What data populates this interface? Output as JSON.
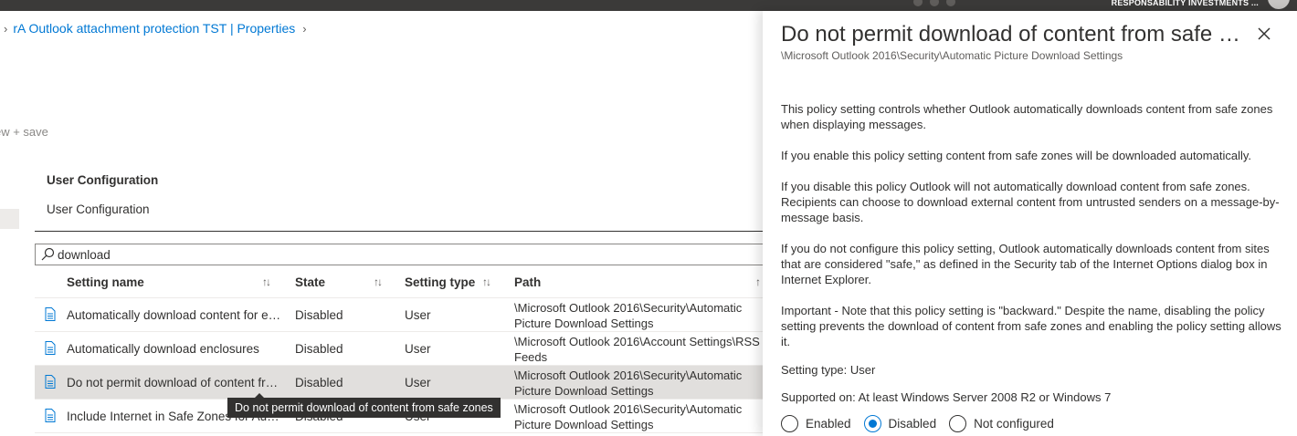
{
  "topbar": {
    "tenant": "RESPONSABILITY INVESTMENTS ..."
  },
  "breadcrumb": {
    "item": "rA Outlook attachment protection TST | Properties"
  },
  "step": {
    "label": "ew + save"
  },
  "section": {
    "title": "User Configuration",
    "subtitle": "User Configuration"
  },
  "search": {
    "value": "download",
    "placeholder": ""
  },
  "table": {
    "headers": {
      "name": "Setting name",
      "state": "State",
      "type": "Setting type",
      "path": "Path"
    },
    "rows": [
      {
        "name": "Automatically download content for e-mail in Safe Zones",
        "state": "Disabled",
        "type": "User",
        "path": "\\Microsoft Outlook 2016\\Security\\Automatic Picture Download Settings"
      },
      {
        "name": "Automatically download enclosures",
        "state": "Disabled",
        "type": "User",
        "path": "\\Microsoft Outlook 2016\\Account Settings\\RSS Feeds"
      },
      {
        "name": "Do not permit download of content from safe zones",
        "state": "Disabled",
        "type": "User",
        "path": "\\Microsoft Outlook 2016\\Security\\Automatic Picture Download Settings"
      },
      {
        "name": "Include Internet in Safe Zones for Automatic Picture Download",
        "state": "Disabled",
        "type": "User",
        "path": "\\Microsoft Outlook 2016\\Security\\Automatic Picture Download Settings"
      }
    ]
  },
  "tooltip": {
    "text": "Do not permit download of content from safe zones"
  },
  "panel": {
    "title": "Do not permit download of content from safe zones",
    "path": "\\Microsoft Outlook 2016\\Security\\Automatic Picture Download Settings",
    "paragraphs": [
      "This policy setting controls whether Outlook automatically downloads content from safe zones when displaying messages.",
      "If you enable this policy setting content from safe zones will be downloaded automatically.",
      "If you disable this policy Outlook will not automatically download content from safe zones. Recipients can choose to download external content from untrusted senders on a message-by-message basis.",
      "If you do not configure this policy setting, Outlook automatically downloads content from sites that are considered \"safe,\" as defined in the Security tab of the Internet Options dialog box in Internet Explorer.",
      "Important - Note that this policy setting is \"backward.\" Despite the name, disabling the policy setting prevents the download of content from safe zones and enabling the policy setting allows it.",
      "Setting type: User",
      "Supported on: At least Windows Server 2008 R2 or Windows 7"
    ],
    "options": [
      {
        "label": "Enabled",
        "selected": false
      },
      {
        "label": "Disabled",
        "selected": true
      },
      {
        "label": "Not configured",
        "selected": false
      }
    ]
  },
  "colors": {
    "accent": "#0078d4",
    "topbar": "#3b3a39",
    "selected_row": "#e1dfdd"
  }
}
